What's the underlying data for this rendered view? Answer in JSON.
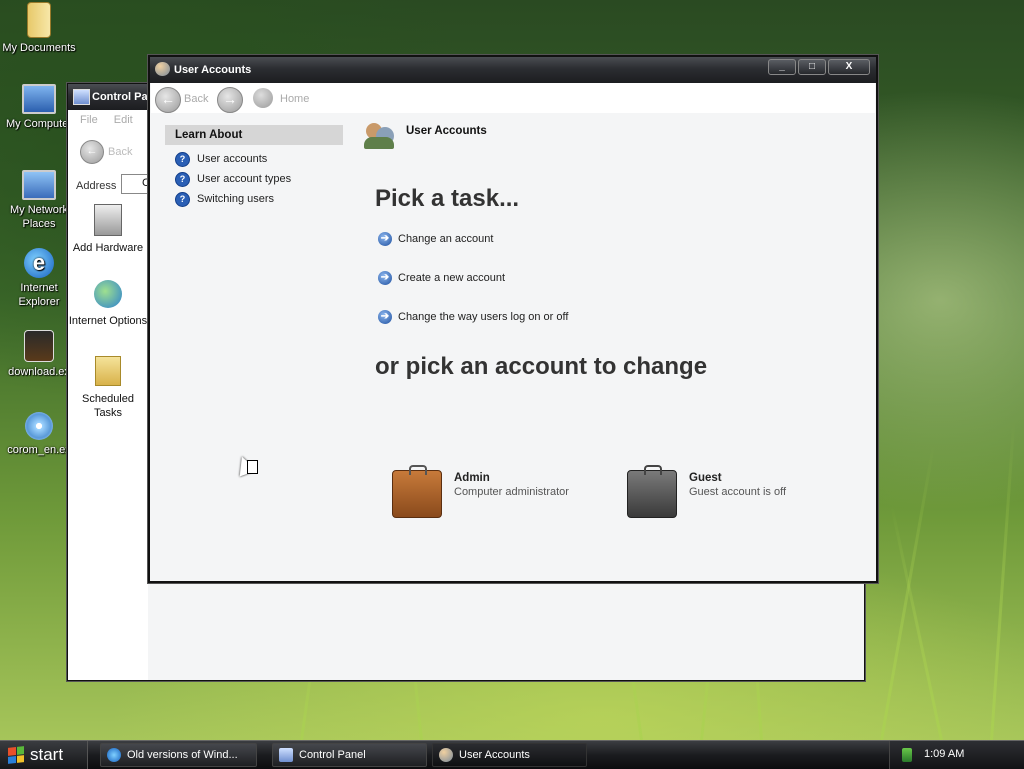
{
  "desktop": {
    "icons": [
      {
        "label": "My Documents"
      },
      {
        "label": "My Computer"
      },
      {
        "label": "My Network Places"
      },
      {
        "label": "Internet Explorer"
      },
      {
        "label": "download.ex"
      },
      {
        "label": "corom_en.ex"
      }
    ]
  },
  "control_panel": {
    "title": "Control Pa",
    "menu": [
      "File",
      "Edit"
    ],
    "back_label": "Back",
    "address_label": "Address",
    "address_value": "C",
    "items": [
      {
        "label": "Add Hardware"
      },
      {
        "label": "Internet Options"
      },
      {
        "label": "Scheduled Tasks"
      }
    ]
  },
  "user_accounts": {
    "title": "User Accounts",
    "controls": {
      "minimize": "_",
      "maximize": "□",
      "close": "X"
    },
    "toolbar": {
      "back": "Back",
      "forward": "",
      "home": "Home"
    },
    "header_title": "User Accounts",
    "learn_about": {
      "heading": "Learn About",
      "links": [
        "User accounts",
        "User account types",
        "Switching users"
      ]
    },
    "pick_task_heading": "Pick a task...",
    "tasks": [
      "Change an account",
      "Create a new account",
      "Change the way users log on or off"
    ],
    "pick_account_heading": "or pick an account to change",
    "accounts": [
      {
        "name": "Admin",
        "description": "Computer administrator"
      },
      {
        "name": "Guest",
        "description": "Guest account is off"
      }
    ]
  },
  "taskbar": {
    "start_label": "start",
    "buttons": [
      {
        "label": "Old versions of Wind..."
      },
      {
        "label": "Control Panel"
      },
      {
        "label": "User Accounts"
      }
    ],
    "clock": "1:09 AM"
  },
  "colors": {
    "accent": "#2a5fb5",
    "title_bar": "#2b2d31",
    "desktop_green": "#6f9a3a"
  }
}
